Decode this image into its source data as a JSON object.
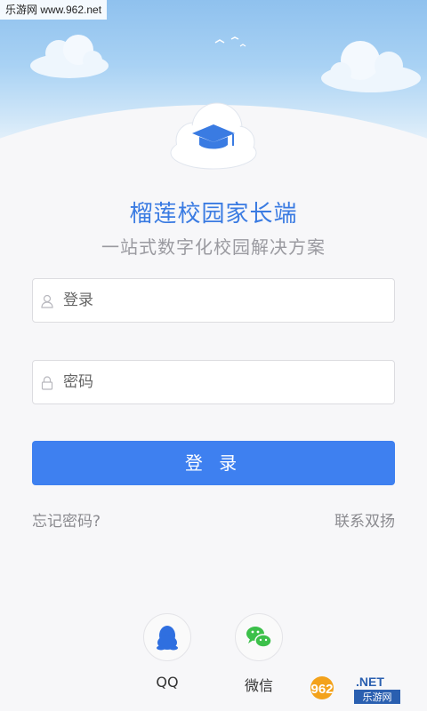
{
  "watermark_top": "乐游网 www.962.net",
  "app": {
    "title": "榴莲校园家长端",
    "subtitle": "一站式数字化校园解决方案"
  },
  "form": {
    "username_placeholder": "登录",
    "password_placeholder": "密码",
    "login_button": "登 录",
    "forgot_password": "忘记密码?",
    "contact": "联系双扬"
  },
  "social": {
    "qq_label": "QQ",
    "wechat_label": "微信"
  },
  "watermark_bottom": {
    "number": "962",
    "suffix": ".NET",
    "text": "乐游网"
  },
  "colors": {
    "accent": "#3e80f0",
    "title": "#3a7be2",
    "qq": "#2f6fe0",
    "wechat": "#3cc04a"
  }
}
